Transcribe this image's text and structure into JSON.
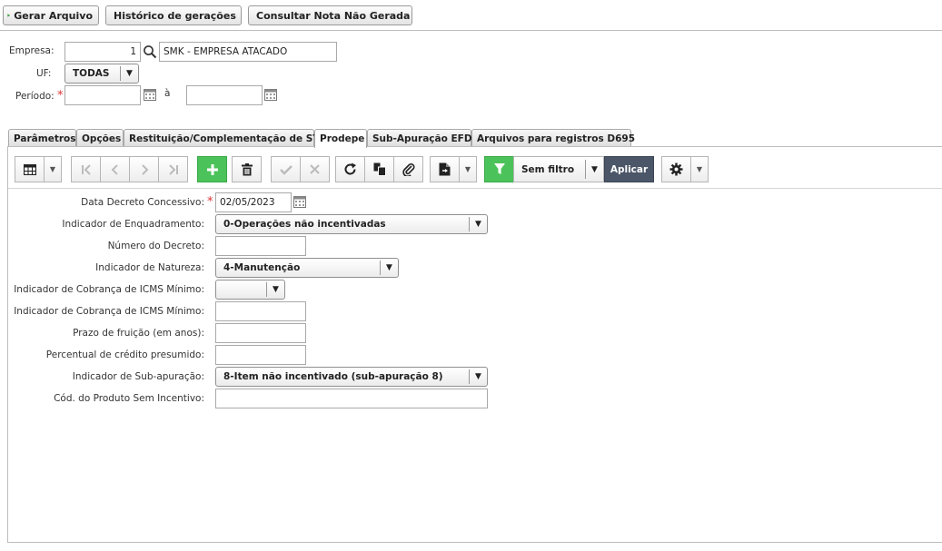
{
  "toolbar": {
    "gerar": "Gerar Arquivo",
    "historico": "Histórico de gerações",
    "consultar": "Consultar Nota Não Gerada"
  },
  "header": {
    "empresa_label": "Empresa:",
    "empresa_code": "1",
    "empresa_name": "SMK - EMPRESA ATACADO",
    "uf_label": "UF:",
    "uf_value": "TODAS",
    "periodo_label": "Período:",
    "periodo_from": "",
    "periodo_sep": "à",
    "periodo_to": ""
  },
  "tabs": [
    {
      "label": "Parâmetros"
    },
    {
      "label": "Opções"
    },
    {
      "label": "Restituição/Complementação de ST"
    },
    {
      "label": "Prodepe"
    },
    {
      "label": "Sub-Apuração EFD"
    },
    {
      "label": "Arquivos para registros D695"
    }
  ],
  "active_tab": "Prodepe",
  "grid_toolbar": {
    "filter_value": "Sem filtro",
    "apply_label": "Aplicar"
  },
  "form": {
    "data_decreto_label": "Data Decreto Concessivo:",
    "data_decreto_value": "02/05/2023",
    "enquadramento_label": "Indicador de Enquadramento:",
    "enquadramento_value": "0-Operações não incentivadas",
    "numero_decreto_label": "Número do Decreto:",
    "numero_decreto_value": "",
    "natureza_label": "Indicador de Natureza:",
    "natureza_value": "4-Manutenção",
    "cobranca_sel_label": "Indicador de Cobrança de ICMS Mínimo:",
    "cobranca_sel_value": "",
    "cobranca_inp_label": "Indicador de Cobrança de ICMS Mínimo:",
    "cobranca_inp_value": "",
    "prazo_label": "Prazo de fruição (em anos):",
    "prazo_value": "",
    "percentual_label": "Percentual de crédito presumido:",
    "percentual_value": "",
    "subapuracao_label": "Indicador de Sub-apuração:",
    "subapuracao_value": "8-Item não incentivado (sub-apuração 8)",
    "cod_produto_label": "Cód. do Produto Sem Incentivo:",
    "cod_produto_value": ""
  },
  "colors": {
    "accent_green": "#4cc35a",
    "apply_button": "#4b5668",
    "required": "#d33333"
  }
}
